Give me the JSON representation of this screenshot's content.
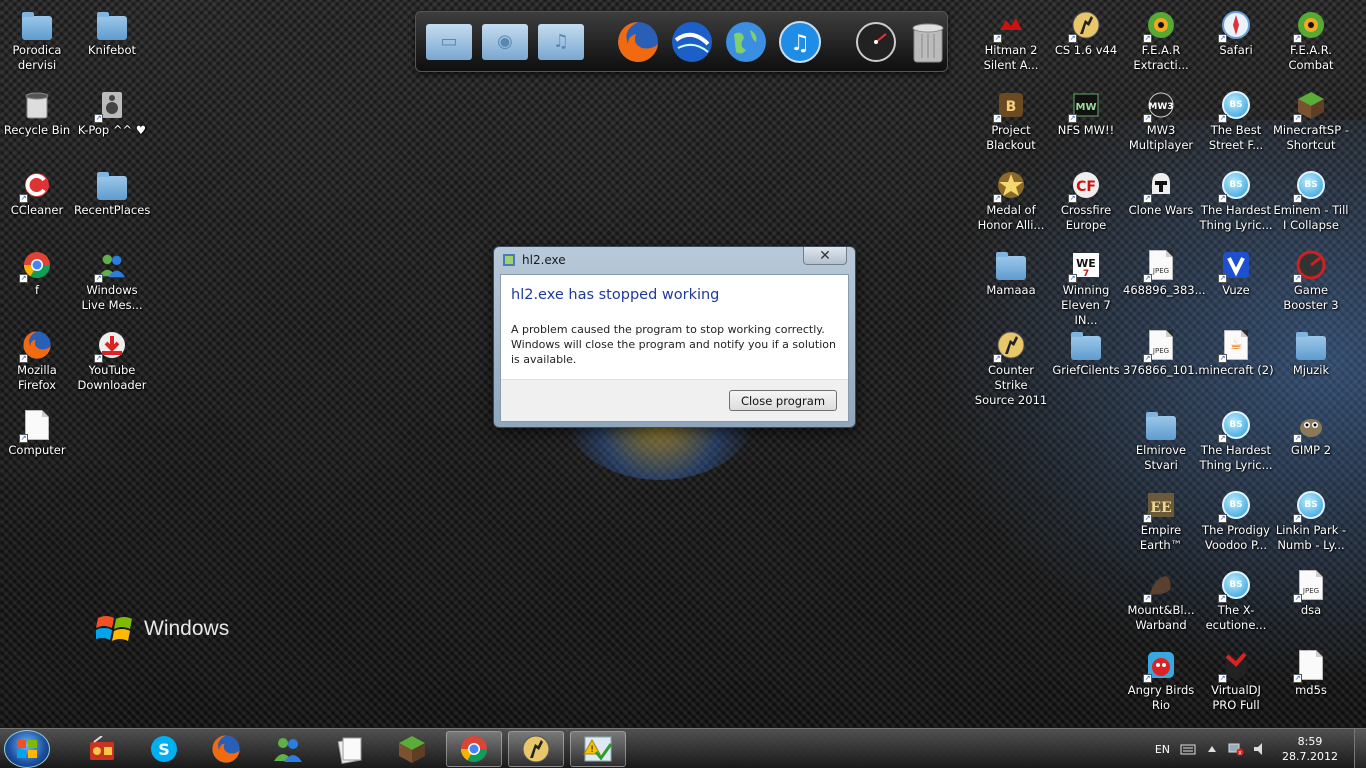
{
  "desktop": {
    "left_icons": [
      {
        "label": "Porodica dervisi",
        "icon": "folder"
      },
      {
        "label": "Knifebot",
        "icon": "folder"
      },
      {
        "label": "Recycle Bin",
        "icon": "recycle-bin"
      },
      {
        "label": "K-Pop ^^ ♥",
        "icon": "speaker"
      },
      {
        "label": "CCleaner",
        "icon": "ccleaner"
      },
      {
        "label": "RecentPlaces",
        "icon": "folder"
      },
      {
        "label": "f",
        "icon": "chrome"
      },
      {
        "label": "Windows Live Mes...",
        "icon": "messenger"
      },
      {
        "label": "Mozilla Firefox",
        "icon": "firefox"
      },
      {
        "label": "YouTube Downloader",
        "icon": "youtube-downloader"
      },
      {
        "label": "Computer",
        "icon": "file"
      }
    ],
    "right_icons": [
      {
        "label": "Hitman 2 Silent A...",
        "icon": "hitman"
      },
      {
        "label": "CS 1.6 v44",
        "icon": "counter-strike"
      },
      {
        "label": "F.E.A.R Extracti...",
        "icon": "fear"
      },
      {
        "label": "Safari",
        "icon": "safari"
      },
      {
        "label": "F.E.A.R. Combat",
        "icon": "fear"
      },
      {
        "label": "Project Blackout",
        "icon": "game"
      },
      {
        "label": "NFS MW!!",
        "icon": "nfs"
      },
      {
        "label": "MW3 Multiplayer",
        "icon": "mw3"
      },
      {
        "label": "The Best Street F...",
        "icon": "bs"
      },
      {
        "label": "MinecraftSP - Shortcut",
        "icon": "minecraft"
      },
      {
        "label": "Medal of Honor Alli...",
        "icon": "medal"
      },
      {
        "label": "Crossfire Europe",
        "icon": "crossfire"
      },
      {
        "label": "Clone Wars",
        "icon": "clone-trooper"
      },
      {
        "label": "The Hardest Thing Lyric...",
        "icon": "bs"
      },
      {
        "label": "Eminem - Till I Collapse",
        "icon": "bs"
      },
      {
        "label": "Mamaaa",
        "icon": "folder"
      },
      {
        "label": "Winning Eleven 7 IN...",
        "icon": "we7"
      },
      {
        "label": "468896_383...",
        "icon": "jpeg"
      },
      {
        "label": "Vuze",
        "icon": "vuze"
      },
      {
        "label": "Game Booster 3",
        "icon": "game-booster"
      },
      {
        "label": "Counter Strike Source 2011",
        "icon": "counter-strike"
      },
      {
        "label": "GriefCilents",
        "icon": "folder"
      },
      {
        "label": "376866_101...",
        "icon": "jpeg"
      },
      {
        "label": "minecraft (2)",
        "icon": "java"
      },
      {
        "label": "Mjuzik",
        "icon": "folder"
      },
      {
        "label": "Elmirove Stvari",
        "icon": "folder"
      },
      {
        "label": "The Hardest Thing Lyric...",
        "icon": "bs"
      },
      {
        "label": "GIMP 2",
        "icon": "gimp"
      },
      {
        "label": "Empire Earth™",
        "icon": "empire-earth"
      },
      {
        "label": "The Prodigy Voodoo P...",
        "icon": "bs"
      },
      {
        "label": "Linkin Park - Numb - Ly...",
        "icon": "bs"
      },
      {
        "label": "Mount&Bl... Warband",
        "icon": "mount-blade"
      },
      {
        "label": "The X-ecutione...",
        "icon": "bs"
      },
      {
        "label": "dsa",
        "icon": "jpeg"
      },
      {
        "label": "Angry Birds Rio",
        "icon": "angry-birds"
      },
      {
        "label": "VirtualDJ PRO Full",
        "icon": "virtualdj"
      },
      {
        "label": "md5s",
        "icon": "file"
      }
    ],
    "wallpaper_logo": "Windows"
  },
  "dock": {
    "items": [
      "documents-folder-icon",
      "pictures-folder-icon",
      "music-folder-icon",
      "firefox-icon",
      "google-earth-icon",
      "globe-icon",
      "itunes-icon",
      "dashboard-icon",
      "trash-icon"
    ]
  },
  "dialog": {
    "title": "hl2.exe",
    "heading": "hl2.exe has stopped working",
    "message": "A problem caused the program to stop working correctly. Windows will close the program and notify you if a solution is available.",
    "button_label": "Close program",
    "close_glyph": "✕"
  },
  "taskbar": {
    "language": "EN",
    "time": "8:59",
    "date": "28.7.2012"
  },
  "colors": {
    "dialog_heading": "#1e3a9a",
    "accent": "#2a9ad8"
  }
}
